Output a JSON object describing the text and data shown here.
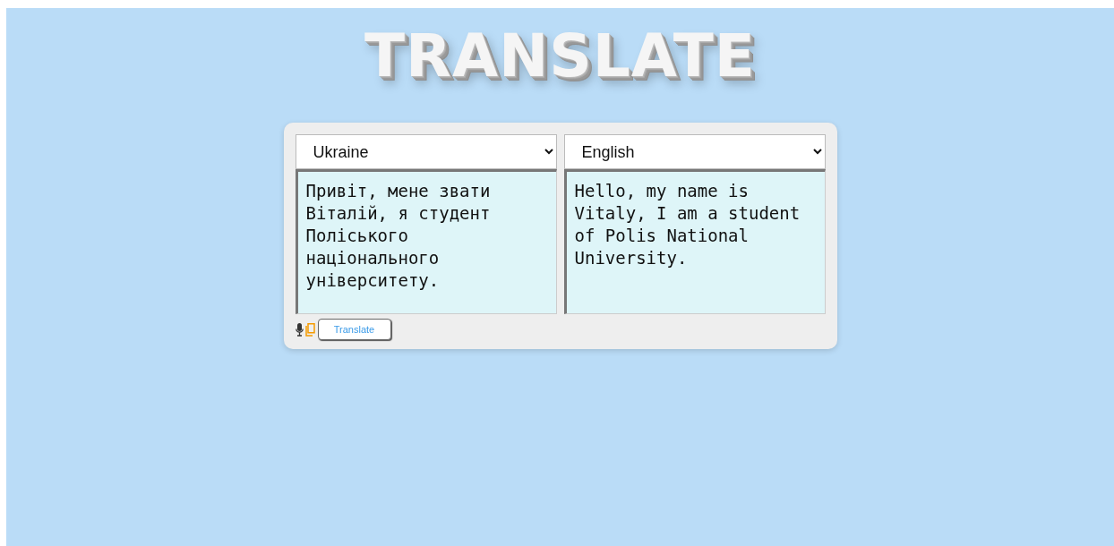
{
  "title": "TRANSLATE",
  "panels": [
    {
      "language": "Ukraine",
      "text": "Привіт, мене звати Віталій, я студент Поліського національного університету."
    },
    {
      "language": "English",
      "text": "Hello, my name is Vitaly, I am a student of Polis National University."
    }
  ],
  "button": "Translate"
}
